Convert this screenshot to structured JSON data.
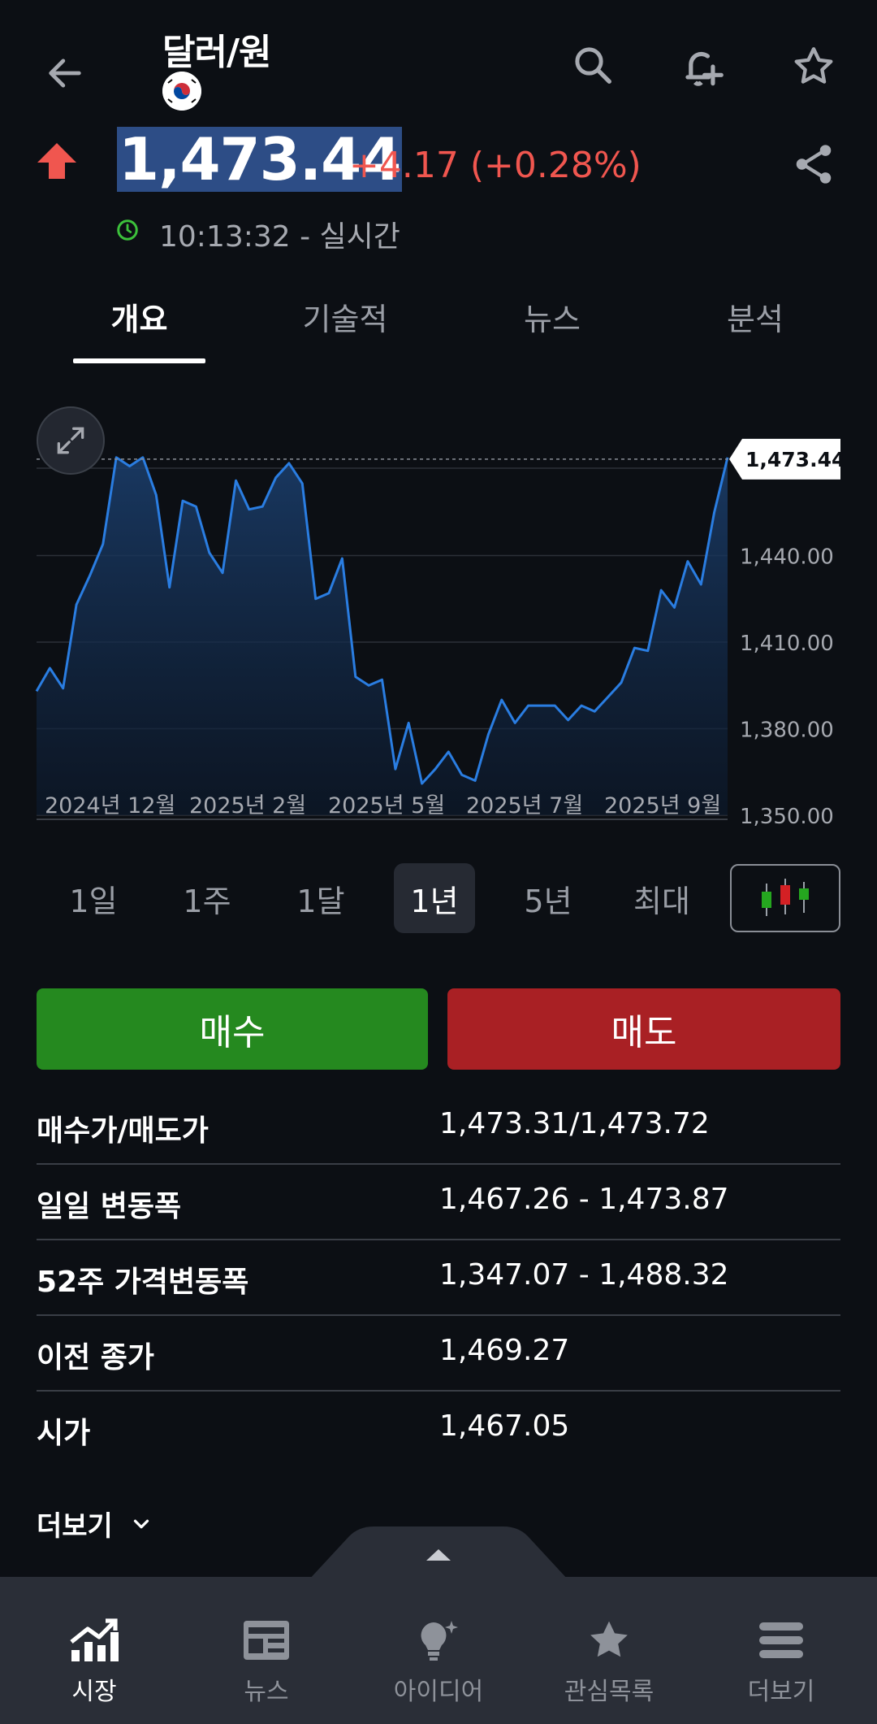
{
  "header": {
    "title": "달러/원",
    "back_icon": "back-arrow-icon",
    "actions": [
      "search-icon",
      "add-alert-icon",
      "star-icon"
    ]
  },
  "quote": {
    "price": "1,473.44",
    "change": "+4.17 (+0.28%)",
    "direction": "up",
    "time": "10:13:32 - 실시간",
    "up_color": "#f0564f"
  },
  "tabs": [
    {
      "label": "개요",
      "active": true
    },
    {
      "label": "기술적",
      "active": false
    },
    {
      "label": "뉴스",
      "active": false
    },
    {
      "label": "분석",
      "active": false
    }
  ],
  "chart_data": {
    "type": "area",
    "x_tick_labels": [
      "2024년 12월",
      "2025년 2월",
      "2025년 5월",
      "2025년 7월",
      "2025년 9월"
    ],
    "y_tick_labels": [
      "1,440.00",
      "1,410.00",
      "1,380.00",
      "1,350.00"
    ],
    "ylim": [
      1350,
      1481
    ],
    "current_label": "1,473.44",
    "current_value": 1473.44,
    "values": [
      1393,
      1401,
      1394,
      1423,
      1433,
      1444,
      1474,
      1471,
      1474,
      1461,
      1429,
      1459,
      1457,
      1441,
      1434,
      1466,
      1456,
      1457,
      1467,
      1472,
      1465,
      1425,
      1427,
      1439,
      1398,
      1395,
      1397,
      1366,
      1382,
      1361,
      1366,
      1372,
      1364,
      1362,
      1378,
      1390,
      1382,
      1388,
      1388,
      1388,
      1383,
      1388,
      1386,
      1391,
      1396,
      1408,
      1407,
      1428,
      1422,
      1438,
      1430,
      1455,
      1474
    ],
    "line_color": "#2a7de1",
    "grid": true
  },
  "ranges": [
    {
      "label": "1일",
      "active": false
    },
    {
      "label": "1주",
      "active": false
    },
    {
      "label": "1달",
      "active": false
    },
    {
      "label": "1년",
      "active": true
    },
    {
      "label": "5년",
      "active": false
    },
    {
      "label": "최대",
      "active": false
    }
  ],
  "trade": {
    "buy_label": "매수",
    "sell_label": "매도",
    "buy_color": "#25891f",
    "sell_color": "#a92024"
  },
  "stats": [
    {
      "label": "매수가/매도가",
      "value": "1,473.31/1,473.72"
    },
    {
      "label": "일일 변동폭",
      "value": "1,467.26 - 1,473.87"
    },
    {
      "label": "52주 가격변동폭",
      "value": "1,347.07 - 1,488.32"
    },
    {
      "label": "이전 종가",
      "value": "1,469.27"
    },
    {
      "label": "시가",
      "value": "1,467.05"
    }
  ],
  "more_label": "더보기",
  "bottom_nav": [
    {
      "label": "시장",
      "icon": "market-chart-icon",
      "active": true
    },
    {
      "label": "뉴스",
      "icon": "newspaper-icon",
      "active": false
    },
    {
      "label": "아이디어",
      "icon": "lightbulb-icon",
      "active": false
    },
    {
      "label": "관심목록",
      "icon": "star-icon",
      "active": false
    },
    {
      "label": "더보기",
      "icon": "menu-icon",
      "active": false
    }
  ]
}
